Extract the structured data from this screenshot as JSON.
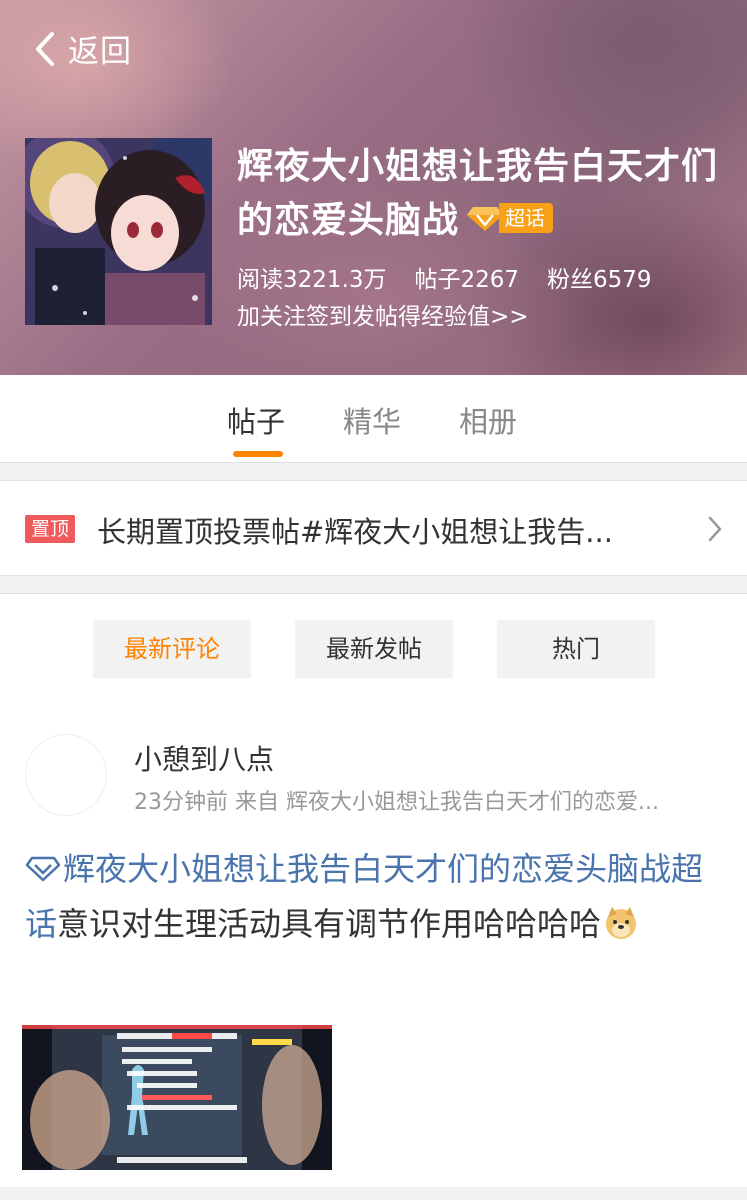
{
  "header": {
    "back_label": "返回",
    "title": "辉夜大小姐想让我告白天才们的恋爱头脑战",
    "badge": "超话",
    "stats": {
      "reads": "阅读3221.3万",
      "posts": "帖子2267",
      "fans": "粉丝6579"
    },
    "hint": "加关注签到发帖得经验值>>"
  },
  "tabs": [
    "帖子",
    "精华",
    "相册"
  ],
  "pinned": {
    "tag": "置顶",
    "text": "长期置顶投票帖#辉夜大小姐想让我告..."
  },
  "filters": [
    "最新评论",
    "最新发帖",
    "热门"
  ],
  "post": {
    "username": "小憩到八点",
    "meta": "23分钟前 来自 辉夜大小姐想让我告白天才们的恋爱...",
    "topic": "辉夜大小姐想让我告白天才们的恋爱头脑战超话",
    "body": "意识对生理活动具有调节作用哈哈哈哈"
  },
  "colors": {
    "accent": "#ff8200",
    "pin_tag": "#f05a5a",
    "topic_link": "#4a74ad",
    "badge": "#f7a11a"
  },
  "icons": [
    "back-arrow-icon",
    "diamond-gem-icon",
    "chevron-right-icon",
    "topic-diamond-icon",
    "doge-emoji-icon"
  ]
}
